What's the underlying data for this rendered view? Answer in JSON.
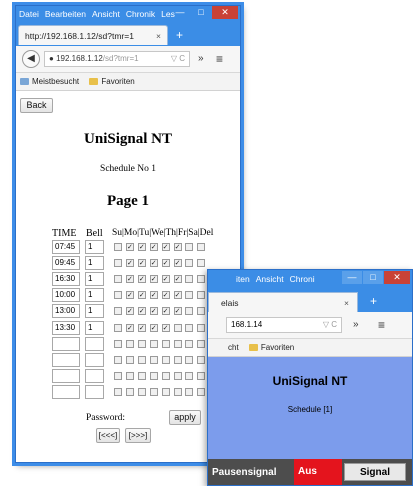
{
  "window1": {
    "menu": [
      "Datei",
      "Bearbeiten",
      "Ansicht",
      "Chronik",
      "Les"
    ],
    "controls": {
      "minimize": "—",
      "maximize": "□",
      "close": "✕"
    },
    "tab": {
      "title": "http://192.168.1.12/sd?tmr=1",
      "close": "×"
    },
    "new_tab": "+",
    "nav": {
      "url_host": "192.168.1.12",
      "url_path": "/sd?tmr=1",
      "reload": "▽ C",
      "overflow": "»",
      "menu": "≡"
    },
    "bookmarks": [
      "Meistbesucht",
      "Favoriten"
    ],
    "page": {
      "back_button": "Back",
      "title": "UniSignal NT",
      "schedule": "Schedule No 1",
      "page_heading": "Page 1",
      "columns": {
        "time": "TIME",
        "bell": "Bell",
        "days": "Su|Mo|Tu|We|Th|Fr|Sa|Del"
      },
      "rows": [
        {
          "time": "07:45",
          "bell": "1",
          "days": [
            false,
            true,
            true,
            true,
            true,
            true,
            false,
            false
          ]
        },
        {
          "time": "09:45",
          "bell": "1",
          "days": [
            false,
            true,
            true,
            true,
            true,
            true,
            false,
            false
          ]
        },
        {
          "time": "16:30",
          "bell": "1",
          "days": [
            false,
            true,
            true,
            true,
            true,
            true,
            false,
            false
          ]
        },
        {
          "time": "10:00",
          "bell": "1",
          "days": [
            false,
            true,
            true,
            true,
            true,
            true,
            false,
            false
          ]
        },
        {
          "time": "13:00",
          "bell": "1",
          "days": [
            false,
            true,
            true,
            true,
            true,
            true,
            false,
            false
          ]
        },
        {
          "time": "13:30",
          "bell": "1",
          "days": [
            false,
            true,
            true,
            true,
            true,
            false,
            false,
            false
          ]
        },
        {
          "time": "",
          "bell": "",
          "days": [
            false,
            false,
            false,
            false,
            false,
            false,
            false,
            false
          ]
        },
        {
          "time": "",
          "bell": "",
          "days": [
            false,
            false,
            false,
            false,
            false,
            false,
            false,
            false
          ]
        },
        {
          "time": "",
          "bell": "",
          "days": [
            false,
            false,
            false,
            false,
            false,
            false,
            false,
            false
          ]
        },
        {
          "time": "",
          "bell": "",
          "days": [
            false,
            false,
            false,
            false,
            false,
            false,
            false,
            false
          ]
        }
      ],
      "password_label": "Password:",
      "apply_button": "apply",
      "prev_button": "[<<<]",
      "next_button": "[>>>]"
    }
  },
  "window2": {
    "menu": [
      "iten",
      "Ansicht",
      "Chroni"
    ],
    "controls": {
      "minimize": "—",
      "maximize": "□",
      "close": "✕"
    },
    "tab": {
      "title": "elais",
      "close": "×"
    },
    "new_tab": "+",
    "nav": {
      "url": "168.1.14",
      "reload": "▽ C",
      "overflow": "»",
      "menu": "≡"
    },
    "bookmarks": [
      "cht",
      "Favoriten"
    ],
    "page": {
      "title": "UniSignal NT",
      "schedule": "Schedule [1]",
      "pause_label": "Pausensignal",
      "status": "Aus",
      "signal_button": "Signal"
    }
  },
  "colors": {
    "frame": "#3b8de6",
    "page2_bg": "#7c9cec",
    "status_red": "#e4141d",
    "bottom_bar": "#4d4d4d"
  }
}
